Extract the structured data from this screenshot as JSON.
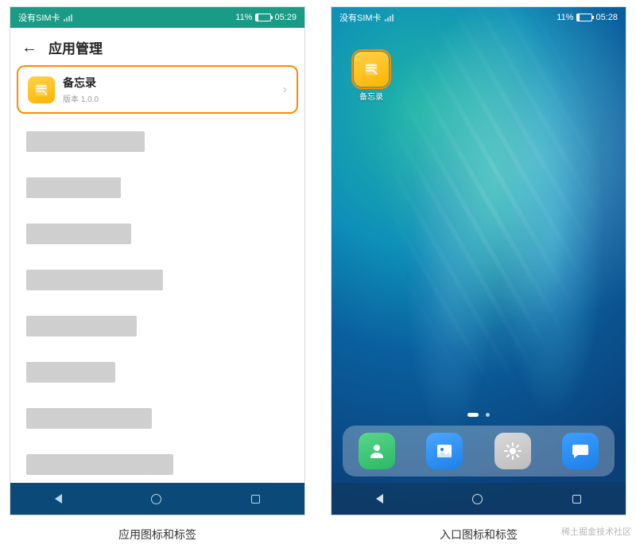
{
  "left": {
    "status": {
      "sim": "没有SIM卡",
      "battery": "11%",
      "time": "05:29"
    },
    "header": {
      "title": "应用管理"
    },
    "app": {
      "name": "备忘录",
      "version": "版本 1.0.0"
    },
    "caption": "应用图标和标签"
  },
  "right": {
    "status": {
      "sim": "没有SIM卡",
      "battery": "11%",
      "time": "05:28"
    },
    "home_app": {
      "label": "备忘录"
    },
    "caption": "入口图标和标签"
  },
  "watermark": "稀土掘金技术社区"
}
